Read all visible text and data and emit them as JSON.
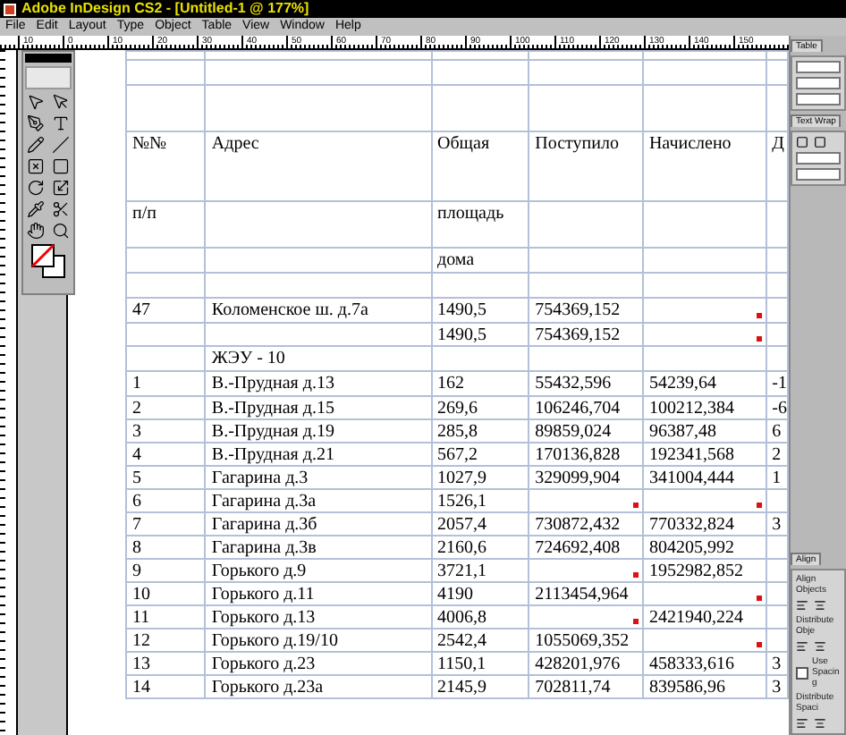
{
  "window": {
    "title": "Adobe InDesign CS2 - [Untitled-1 @ 177%]"
  },
  "menu": [
    "File",
    "Edit",
    "Layout",
    "Type",
    "Object",
    "Table",
    "View",
    "Window",
    "Help"
  ],
  "ruler": {
    "labels": [
      "10",
      "0",
      "10",
      "20",
      "30",
      "40",
      "50",
      "60",
      "70",
      "80",
      "90",
      "100",
      "110",
      "120",
      "130",
      "140",
      "150"
    ]
  },
  "table": {
    "rows": [
      {
        "kind": "thin",
        "cells": []
      },
      {
        "kind": "normal",
        "cells": []
      },
      {
        "kind": "medium",
        "cells": []
      },
      {
        "kind": "tall",
        "cells": [
          {
            "text": "№№",
            "overset": false
          },
          {
            "text": "Адрес",
            "overset": false
          },
          {
            "text": "Общая",
            "overset": false
          },
          {
            "text": "Поступило",
            "overset": false
          },
          {
            "text": "Начислено",
            "overset": false
          },
          {
            "text": "Д",
            "overset": false
          }
        ]
      },
      {
        "kind": "medium",
        "cells": [
          {
            "text": "п/п",
            "overset": false
          },
          {
            "overset": false
          },
          {
            "text": "площадь",
            "overset": false
          },
          {
            "overset": false
          },
          {
            "overset": false
          },
          {
            "overset": false
          }
        ]
      },
      {
        "kind": "normal",
        "cells": [
          {
            "overset": false
          },
          {
            "overset": false
          },
          {
            "text": "дома",
            "overset": false
          },
          {
            "overset": false
          },
          {
            "overset": false
          },
          {
            "overset": false
          }
        ]
      },
      {
        "kind": "normal",
        "cells": []
      },
      {
        "kind": "normal",
        "cells": [
          {
            "text": "47",
            "overset": false
          },
          {
            "text": "Коломенское ш. д.7а",
            "overset": false
          },
          {
            "text": "1490,5",
            "overset": false
          },
          {
            "text": "754369,152",
            "overset": false
          },
          {
            "overset": true
          },
          {
            "overset": false
          }
        ]
      },
      {
        "kind": "short",
        "cells": [
          {
            "overset": false
          },
          {
            "overset": false
          },
          {
            "text": "1490,5",
            "overset": false
          },
          {
            "text": "754369,152",
            "overset": false
          },
          {
            "overset": true
          },
          {
            "overset": false
          }
        ]
      },
      {
        "kind": "normal",
        "cells": [
          {
            "overset": false
          },
          {
            "text": "ЖЭУ - 10",
            "overset": false
          },
          {
            "overset": false
          },
          {
            "overset": false
          },
          {
            "overset": false
          },
          {
            "overset": false
          }
        ]
      },
      {
        "kind": "normal",
        "cells": [
          {
            "text": "1",
            "overset": false
          },
          {
            "text": "В.-Прудная д.13",
            "overset": false
          },
          {
            "text": "162",
            "overset": false
          },
          {
            "text": "55432,596",
            "overset": false
          },
          {
            "text": "54239,64",
            "overset": false
          },
          {
            "text": "-1",
            "overset": false
          }
        ]
      },
      {
        "kind": "data",
        "cells": [
          {
            "text": "2",
            "overset": false
          },
          {
            "text": "В.-Прудная д.15",
            "overset": false
          },
          {
            "text": "269,6",
            "overset": false
          },
          {
            "text": "106246,704",
            "overset": false
          },
          {
            "text": "100212,384",
            "overset": false
          },
          {
            "text": "-6",
            "overset": false
          }
        ]
      },
      {
        "kind": "data",
        "cells": [
          {
            "text": "3",
            "overset": false
          },
          {
            "text": "В.-Прудная д.19",
            "overset": false
          },
          {
            "text": "285,8",
            "overset": false
          },
          {
            "text": "89859,024",
            "overset": false
          },
          {
            "text": "96387,48",
            "overset": false
          },
          {
            "text": "6",
            "overset": false
          }
        ]
      },
      {
        "kind": "data",
        "cells": [
          {
            "text": "4",
            "overset": false
          },
          {
            "text": "В.-Прудная д.21",
            "overset": false
          },
          {
            "text": "567,2",
            "overset": false
          },
          {
            "text": "170136,828",
            "overset": false
          },
          {
            "text": "192341,568",
            "overset": false
          },
          {
            "text": "2",
            "overset": false
          }
        ]
      },
      {
        "kind": "data",
        "cells": [
          {
            "text": "5",
            "overset": false
          },
          {
            "text": "Гагарина д.3",
            "overset": false
          },
          {
            "text": "1027,9",
            "overset": false
          },
          {
            "text": "329099,904",
            "overset": false
          },
          {
            "text": "341004,444",
            "overset": false
          },
          {
            "text": "1",
            "overset": false
          }
        ]
      },
      {
        "kind": "data",
        "cells": [
          {
            "text": "6",
            "overset": false
          },
          {
            "text": "Гагарина д.3а",
            "overset": false
          },
          {
            "text": "1526,1",
            "overset": false
          },
          {
            "overset": true
          },
          {
            "overset": true
          },
          {
            "overset": false
          }
        ]
      },
      {
        "kind": "data",
        "cells": [
          {
            "text": "7",
            "overset": false
          },
          {
            "text": "Гагарина д.3б",
            "overset": false
          },
          {
            "text": "2057,4",
            "overset": false
          },
          {
            "text": "730872,432",
            "overset": false
          },
          {
            "text": "770332,824",
            "overset": false
          },
          {
            "text": "3",
            "overset": false
          }
        ]
      },
      {
        "kind": "data",
        "cells": [
          {
            "text": "8",
            "overset": false
          },
          {
            "text": "Гагарина д.3в",
            "overset": false
          },
          {
            "text": "2160,6",
            "overset": false
          },
          {
            "text": "724692,408",
            "overset": false
          },
          {
            "text": "804205,992",
            "overset": false
          },
          {
            "overset": false
          }
        ]
      },
      {
        "kind": "data",
        "cells": [
          {
            "text": "9",
            "overset": false
          },
          {
            "text": "Горького д.9",
            "overset": false
          },
          {
            "text": "3721,1",
            "overset": false
          },
          {
            "overset": true
          },
          {
            "text": "1952982,852",
            "overset": false
          },
          {
            "overset": false
          }
        ]
      },
      {
        "kind": "data",
        "cells": [
          {
            "text": "10",
            "overset": false
          },
          {
            "text": "Горького д.11",
            "overset": false
          },
          {
            "text": "4190",
            "overset": false
          },
          {
            "text": "2113454,964",
            "overset": false
          },
          {
            "overset": true
          },
          {
            "overset": false
          }
        ]
      },
      {
        "kind": "data",
        "cells": [
          {
            "text": "11",
            "overset": false
          },
          {
            "text": "Горького д.13",
            "overset": false
          },
          {
            "text": "4006,8",
            "overset": false
          },
          {
            "overset": true
          },
          {
            "text": "2421940,224",
            "overset": false
          },
          {
            "overset": false
          }
        ]
      },
      {
        "kind": "data",
        "cells": [
          {
            "text": "12",
            "overset": false
          },
          {
            "text": "Горького д.19/10",
            "overset": false
          },
          {
            "text": "2542,4",
            "overset": false
          },
          {
            "text": "1055069,352",
            "overset": false
          },
          {
            "overset": true
          },
          {
            "overset": false
          }
        ]
      },
      {
        "kind": "data",
        "cells": [
          {
            "text": "13",
            "overset": false
          },
          {
            "text": "Горького д.23",
            "overset": false
          },
          {
            "text": "1150,1",
            "overset": false
          },
          {
            "text": "428201,976",
            "overset": false
          },
          {
            "text": "458333,616",
            "overset": false
          },
          {
            "text": "3",
            "overset": false
          }
        ]
      },
      {
        "kind": "data",
        "cells": [
          {
            "text": "14",
            "overset": false
          },
          {
            "text": "Горького д.23а",
            "overset": false
          },
          {
            "text": "2145,9",
            "overset": false
          },
          {
            "text": "702811,74",
            "overset": false
          },
          {
            "text": "839586,96",
            "overset": false
          },
          {
            "text": "3",
            "overset": false
          }
        ]
      }
    ]
  },
  "panels": {
    "table_tab": "Table",
    "text_wrap_tab": "Text Wrap",
    "align_tab": "Align",
    "align_objects": "Align Objects",
    "distribute_objects": "Distribute Obje",
    "use_spacing": {
      "label": "Use Spacing",
      "checked": false
    },
    "distribute_spacing": "Distribute Spaci"
  }
}
